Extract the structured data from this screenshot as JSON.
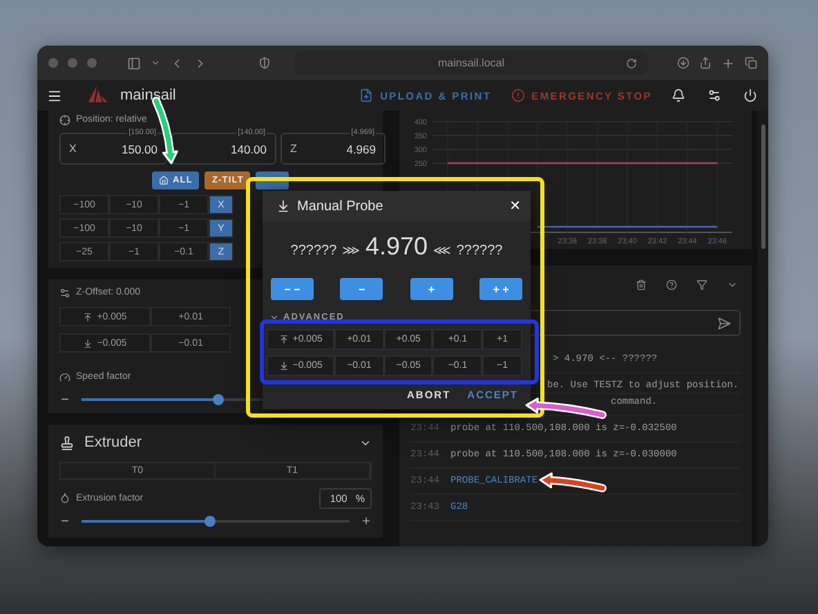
{
  "browser": {
    "address": "mainsail.local"
  },
  "app_bar": {
    "brand": "mainsail",
    "upload": "UPLOAD & PRINT",
    "emergency": "EMERGENCY STOP"
  },
  "position": {
    "title": "Position: relative",
    "axes": [
      {
        "label": "X",
        "target": "[150.00]",
        "value": "150.00"
      },
      {
        "target": "[140.00]",
        "value": "140.00"
      },
      {
        "label": "Z",
        "target": "[4.969]",
        "value": "4.969"
      }
    ],
    "home_buttons": [
      {
        "kind": "home",
        "label": "ALL",
        "color": "#3b6ea8"
      },
      {
        "kind": "text",
        "label": "Z-TILT",
        "color": "#a8692f"
      },
      {
        "kind": "blank",
        "color": "#3b6ea8"
      }
    ],
    "jog_rows": [
      {
        "steps": [
          "−100",
          "−10",
          "−1"
        ],
        "axis": "X"
      },
      {
        "steps": [
          "−100",
          "−10",
          "−1"
        ],
        "axis": "Y"
      },
      {
        "steps": [
          "−25",
          "−1",
          "−0.1"
        ],
        "axis": "Z"
      }
    ]
  },
  "z_offset": {
    "title": "Z-Offset: 0.000",
    "rows": [
      {
        "kind": "up",
        "steps": [
          "+0.005",
          "+0.01"
        ]
      },
      {
        "kind": "down",
        "steps": [
          "−0.005",
          "−0.01"
        ]
      }
    ]
  },
  "speed": {
    "label": "Speed factor",
    "minus": "−",
    "level": 0.47
  },
  "extruder": {
    "title": "Extruder",
    "tools": [
      {
        "label": "T0",
        "selected": false
      },
      {
        "label": "T1",
        "selected": false
      }
    ],
    "factor_label": "Extrusion factor",
    "factor_value": "100",
    "factor_unit": "%",
    "minus": "−",
    "plus": "+",
    "level": 0.48
  },
  "chart": {
    "chart_data": {
      "type": "line",
      "categories": [
        null,
        null,
        null,
        null,
        "23:36",
        "23:38",
        "23:40",
        "23:42",
        "23:44",
        "23:46"
      ],
      "ylim": [
        0,
        400
      ],
      "grid": true,
      "yticks": [
        250,
        300,
        350,
        400
      ],
      "series": [
        {
          "color": "#a8436c",
          "values": [
            250,
            250,
            250,
            250,
            250,
            250,
            250,
            250,
            250,
            250
          ]
        },
        {
          "color": "#4a64b8",
          "values": [
            null,
            null,
            null,
            20,
            20,
            20,
            20,
            20,
            20,
            20
          ]
        }
      ]
    }
  },
  "console": {
    "lines": [
      {
        "kind": "covered",
        "text": "> 4.970 <-- ??????"
      },
      {
        "kind": "covered",
        "text": "be. Use TESTZ to adjust position."
      },
      {
        "kind": "covered",
        "text": "command."
      },
      {
        "kind": "response",
        "time": "23:44",
        "text": "probe at 110.500,108.000 is z=-0.032500"
      },
      {
        "kind": "response",
        "time": "23:44",
        "text": "probe at 110.500,108.000 is z=-0.030000"
      },
      {
        "kind": "command",
        "time": "23:44",
        "text": "PROBE_CALIBRATE"
      },
      {
        "kind": "command",
        "time": "23:43",
        "text": "G28"
      }
    ]
  },
  "modal": {
    "title": "Manual Probe",
    "close": "✕",
    "left": "??????",
    "left_mark": "⋙",
    "value": "4.970",
    "right_mark": "⋘",
    "right": "??????",
    "buttons": [
      "− −",
      "−",
      "+",
      "+ +"
    ],
    "advanced": "ADVANCED",
    "advanced_expanded": true,
    "rows": [
      {
        "kind": "up",
        "steps": [
          "+0.005",
          "+0.01",
          "+0.05",
          "+0.1",
          "+1"
        ]
      },
      {
        "kind": "down",
        "steps": [
          "−0.005",
          "−0.01",
          "−0.05",
          "−0.1",
          "−1"
        ]
      }
    ],
    "actions": [
      {
        "kind": "plain",
        "label": "ABORT"
      },
      {
        "kind": "primary",
        "label": "ACCEPT"
      }
    ]
  },
  "annotations": [
    {
      "kind": "frame",
      "color": "#f3e21b"
    },
    {
      "kind": "frame",
      "color": "#2234e6"
    },
    {
      "kind": "arrow",
      "color": "#25cf7c"
    },
    {
      "kind": "arrow",
      "color": "#dc5ccb"
    },
    {
      "kind": "arrow",
      "color": "#d8421f"
    }
  ]
}
